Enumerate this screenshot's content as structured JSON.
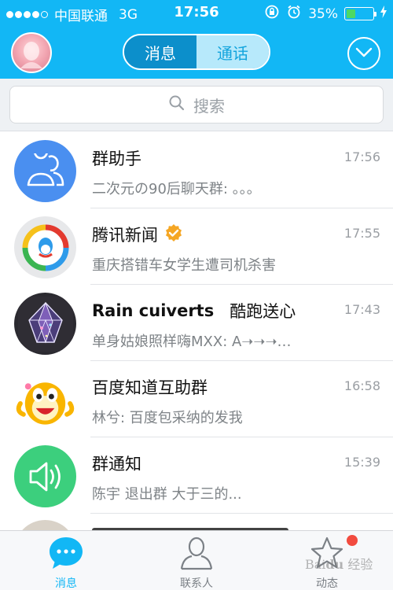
{
  "status_bar": {
    "carrier": "中国联通",
    "network": "3G",
    "time": "17:56",
    "battery_percent": "35%",
    "battery_level": 0.35
  },
  "header": {
    "tabs": [
      {
        "label": "消息",
        "active": true
      },
      {
        "label": "通话",
        "active": false
      }
    ]
  },
  "search": {
    "placeholder": "搜索"
  },
  "chats": [
    {
      "name": "群助手",
      "time": "17:56",
      "message": "二次元の90后聊天群: 。。。",
      "avatar": "group-helper-icon"
    },
    {
      "name": "腾讯新闻",
      "time": "17:55",
      "message": "重庆搭错车女学生遭司机杀害",
      "avatar": "tencent-news-logo",
      "verified": true
    },
    {
      "name": "Rain cuiverts",
      "name_extra": "酷跑送心",
      "time": "17:43",
      "message": "单身姑娘照样嗨MXX: A➝➝➝…",
      "avatar": "diamond-avatar"
    },
    {
      "name": "百度知道互助群",
      "time": "16:58",
      "message": "林兮: 百度包采纳的发我",
      "avatar": "qq-penguin-avatar"
    },
    {
      "name": "群通知",
      "time": "15:39",
      "message": "陈宇 退出群 大于三的...",
      "avatar": "speaker-icon"
    }
  ],
  "tab_bar": {
    "items": [
      {
        "label": "消息",
        "active": true
      },
      {
        "label": "联系人",
        "active": false
      },
      {
        "label": "动态",
        "active": false,
        "badge": true
      }
    ]
  },
  "colors": {
    "brand": "#12b7f5",
    "group_helper_bg": "#4a8ff0",
    "notify_bg": "#3ccf7d"
  }
}
